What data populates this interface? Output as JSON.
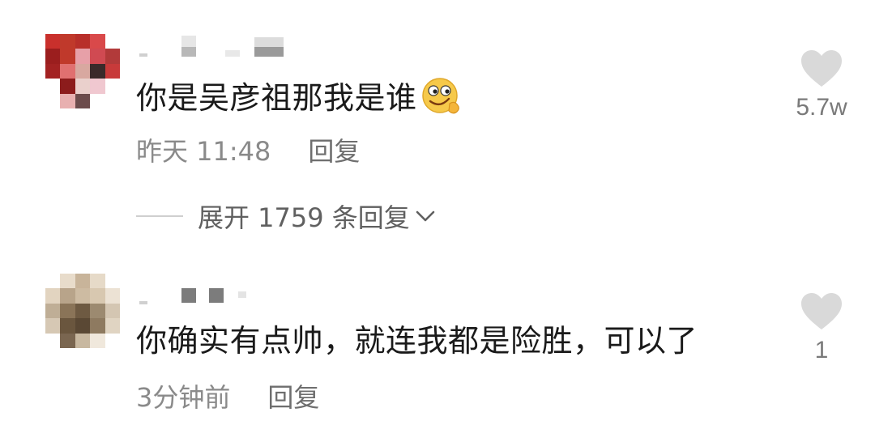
{
  "comments": [
    {
      "text": "你是吴彦祖那我是谁",
      "emoji": "smirking-face-emoji",
      "time": "昨天 11:48",
      "reply_label": "回复",
      "likes": "5.7w",
      "expand_label": "展开 1759 条回复"
    },
    {
      "text": "你确实有点帅，就连我都是险胜，可以了",
      "time": "3分钟前",
      "reply_label": "回复",
      "likes": "1"
    }
  ],
  "icons": {
    "like": "heart-icon",
    "expand": "chevron-down-icon"
  },
  "colors": {
    "text_primary": "#1a1a1a",
    "text_secondary": "#8a8a8a",
    "heart": "#d9d9d9"
  }
}
